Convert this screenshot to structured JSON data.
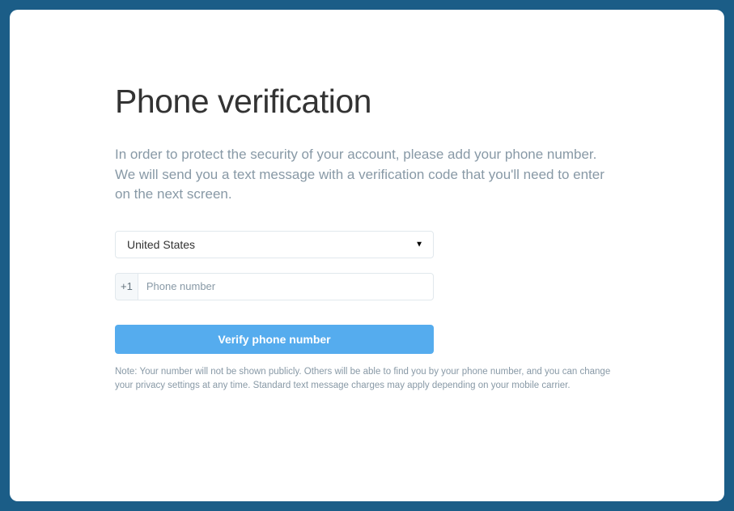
{
  "title": "Phone verification",
  "description": "In order to protect the security of your account, please add your phone number. We will send you a text message with a verification code that you'll need to enter on the next screen.",
  "country": {
    "selected": "United States",
    "code": "+1"
  },
  "phone": {
    "placeholder": "Phone number",
    "value": ""
  },
  "verify_button": "Verify phone number",
  "note": "Note: Your number will not be shown publicly. Others will be able to find you by your phone number, and you can change your privacy settings at any time. Standard text message charges may apply depending on your mobile carrier."
}
